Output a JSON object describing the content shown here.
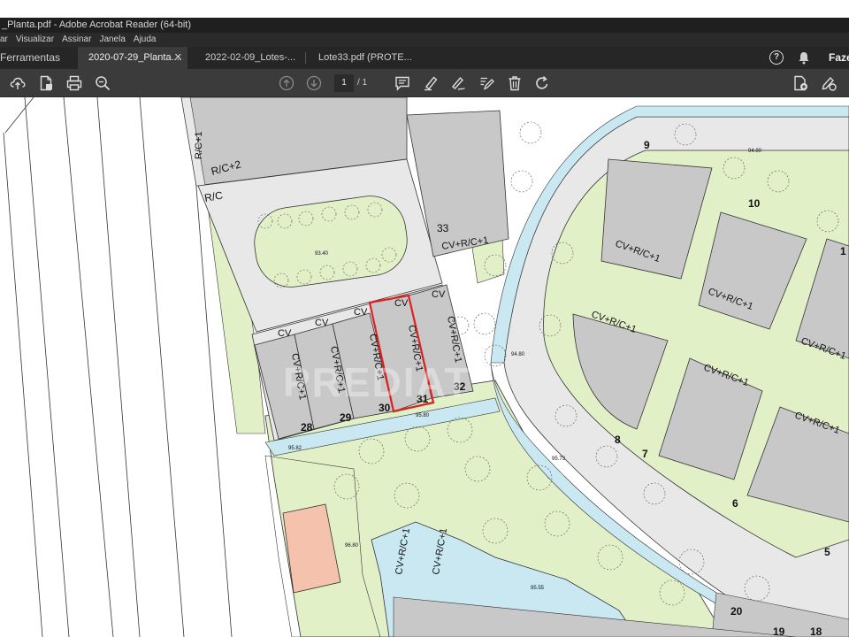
{
  "window": {
    "title": "_Planta.pdf - Adobe Acrobat Reader (64-bit)"
  },
  "menu": {
    "items": [
      "ar",
      "Visualizar",
      "Assinar",
      "Janela",
      "Ajuda"
    ]
  },
  "tabs": {
    "tools": "Ferramentas",
    "items": [
      {
        "label": "2020-07-29_Planta....",
        "active": true,
        "closable": true
      },
      {
        "label": "2022-02-09_Lotes-...",
        "active": false,
        "closable": false
      },
      {
        "label": "Lote33.pdf (PROTE...",
        "active": false,
        "closable": false
      }
    ],
    "help_icon_glyph": "?",
    "sign_in_label": "Faze"
  },
  "toolbar": {
    "current_page": "1",
    "total_pages": "/ 1",
    "icons": [
      "cloud-upload-icon",
      "file-icon",
      "print-icon",
      "zoom-icon",
      "page-up-icon",
      "page-down-icon",
      "comment-icon",
      "highlight-icon",
      "sign-icon",
      "edit-icon",
      "delete-icon",
      "rotate-icon",
      "export-pdf-icon",
      "fill-sign-icon"
    ]
  },
  "map": {
    "colors": {
      "building": "#c8c8c8",
      "pavement": "#e8e8e8",
      "green": "#e2f0c8",
      "water": "#c9e8f2",
      "orange": "#f4c2ad",
      "highlight": "#e02020"
    },
    "labels": {
      "rc1_top": "R/C+1",
      "rc2": "R/C+2",
      "rc": "R/C",
      "lot33_num": "33",
      "lot33_type": "CV+R/C+1",
      "cv": "CV",
      "lot_type": "CV+R/C+1",
      "lot28": "28",
      "lot29": "29",
      "lot30": "30",
      "lot31": "31",
      "lot32": "32",
      "lot9": "9",
      "lot10": "10",
      "lot1_partial": "1",
      "lot8": "8",
      "lot7": "7",
      "lot6": "6",
      "lot5": "5",
      "lot20": "20",
      "lot19": "19",
      "lot18": "18",
      "watermark": "PREDIAT"
    },
    "elevations": [
      "93.40",
      "94.80",
      "95.80",
      "95.82",
      "95.73",
      "96.80",
      "95.55",
      "94.80"
    ]
  }
}
